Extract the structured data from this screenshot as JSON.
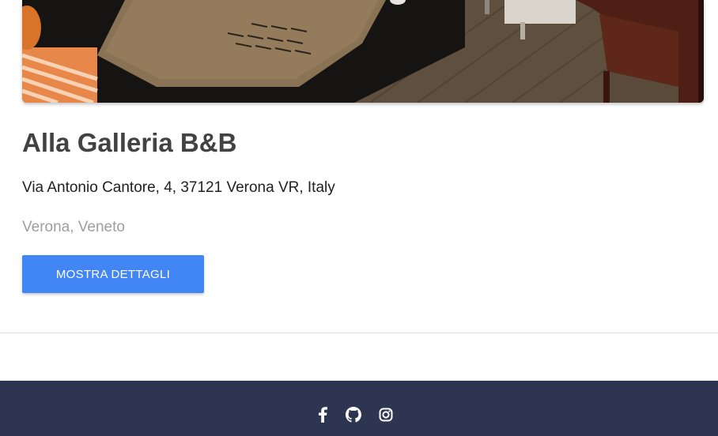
{
  "listing": {
    "image_alt": "room-photo",
    "title": "Alla Galleria B&B",
    "address": "Via Antonio Cantore, 4, 37121 Verona VR, Italy",
    "region": "Verona, Veneto",
    "details_button": "MOSTRA DETTAGLI"
  },
  "footer": {
    "icons": [
      "facebook-icon",
      "github-icon",
      "instagram-icon"
    ]
  },
  "colors": {
    "button": "#4285f4",
    "footer": "#2d3550",
    "title": "#424242",
    "muted": "#9e9e9e"
  }
}
